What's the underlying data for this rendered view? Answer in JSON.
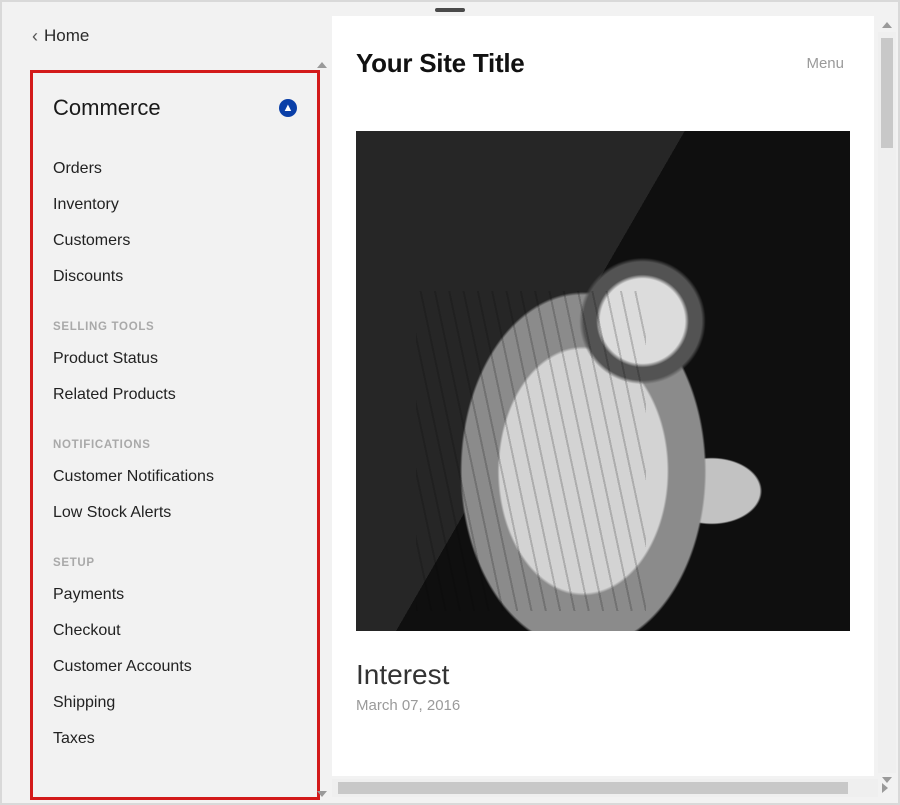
{
  "sidebar": {
    "back_label": "Home",
    "panel_title": "Commerce",
    "badge_glyph": "▲",
    "items": [
      {
        "label": "Orders"
      },
      {
        "label": "Inventory"
      },
      {
        "label": "Customers"
      },
      {
        "label": "Discounts"
      }
    ],
    "sections": [
      {
        "label": "SELLING TOOLS",
        "items": [
          {
            "label": "Product Status"
          },
          {
            "label": "Related Products"
          }
        ]
      },
      {
        "label": "NOTIFICATIONS",
        "items": [
          {
            "label": "Customer Notifications"
          },
          {
            "label": "Low Stock Alerts"
          }
        ]
      },
      {
        "label": "SETUP",
        "items": [
          {
            "label": "Payments"
          },
          {
            "label": "Checkout"
          },
          {
            "label": "Customer Accounts"
          },
          {
            "label": "Shipping"
          },
          {
            "label": "Taxes"
          }
        ]
      }
    ]
  },
  "preview": {
    "site_title": "Your Site Title",
    "menu_label": "Menu",
    "post_title": "Interest",
    "post_date": "March 07, 2016"
  }
}
